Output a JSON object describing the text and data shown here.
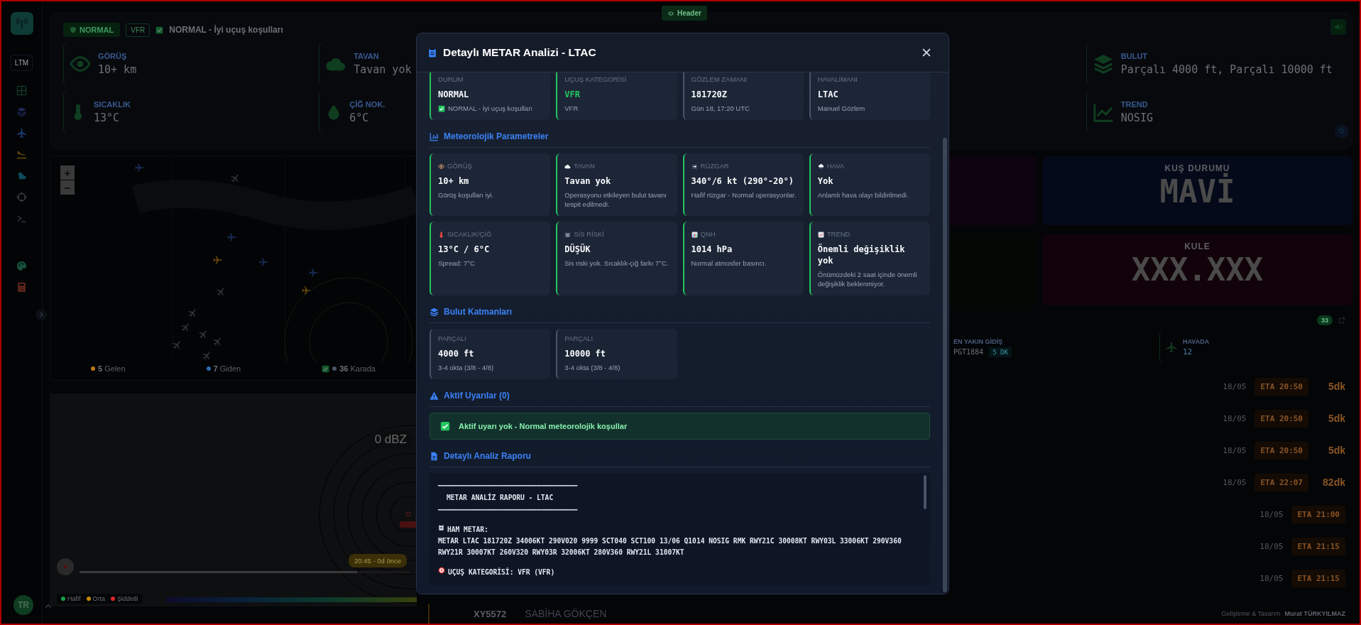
{
  "sidebar": {
    "airport": "LTM",
    "avatar": "TR"
  },
  "header_button": {
    "label": "Header"
  },
  "status": {
    "badge": "NORMAL",
    "category": "VFR",
    "checked": true,
    "text": "NORMAL - İyi uçuş koşulları"
  },
  "metric_columns": [
    [
      {
        "kind": "visibility",
        "label": "GÖRÜŞ",
        "value": "10+ km"
      },
      {
        "kind": "temperature",
        "label": "SICAKLIK",
        "value": "13°C"
      }
    ],
    [
      {
        "kind": "ceiling",
        "label": "TAVAN",
        "value": "Tavan yok"
      },
      {
        "kind": "dewpoint",
        "label": "ÇİĞ NOK.",
        "value": "6°C"
      }
    ],
    [
      {
        "kind": "cloud",
        "label": "BULUT",
        "value": "Parçalı 4000 ft, Parçalı 10000 ft"
      },
      {
        "kind": "trend",
        "label": "TREND",
        "value": "NOSIG"
      }
    ]
  ],
  "flight_map": {
    "zoom_in": "+",
    "zoom_out": "−",
    "ground_checked": true,
    "legend": [
      {
        "count": "5",
        "label": "Gelen",
        "color": "#b7791f"
      },
      {
        "count": "7",
        "label": "Giden",
        "color": "#2b6cb0"
      },
      {
        "count": "36",
        "label": "Karada",
        "color": "#4a5568"
      }
    ]
  },
  "radar": {
    "reading": "0 dBZ",
    "time": "20:45 - 0d önce",
    "timeline": {
      "level": 0.84
    },
    "legend": [
      {
        "label": "Hafif",
        "color": "#16a34a"
      },
      {
        "label": "Orta",
        "color": "#ca8a04"
      },
      {
        "label": "Şiddetli",
        "color": "#dc2626"
      }
    ]
  },
  "panels": {
    "bird": {
      "label": "KUŞ DURUMU",
      "value": "MAVİ"
    },
    "tower": {
      "label": "KULE",
      "value": "XXX.XXX"
    }
  },
  "flights": {
    "count": "33",
    "nearest": {
      "label": "EN YAKIN GİDİŞ",
      "callsign": "PGT1884",
      "eta": "5 DK"
    },
    "airborne": {
      "label": "HAVADA",
      "value": "12"
    },
    "rows": [
      {
        "date": "18/05",
        "eta": "ETA 20:50",
        "minutes": "5dk"
      },
      {
        "date": "18/05",
        "eta": "ETA 20:50",
        "minutes": "5dk"
      },
      {
        "date": "18/05",
        "eta": "ETA 20:50",
        "minutes": "5dk"
      },
      {
        "date": "18/05",
        "eta": "ETA 22:07",
        "minutes": "82dk"
      },
      {
        "date": "18/05",
        "eta": "ETA 21:00"
      },
      {
        "date": "18/05",
        "eta": "ETA 21:15"
      },
      {
        "date": "18/05",
        "eta": "ETA 21:15"
      }
    ]
  },
  "bottom_bar": {
    "flight": "XY5572",
    "airport": "SABİHA GÖKÇEN",
    "credit": "Geliştirme & Tasarım",
    "author": "Murat TÜRKYILMAZ"
  },
  "modal": {
    "title": "Detaylı METAR Analizi - LTAC",
    "summary": [
      {
        "label": "DURUM",
        "value": "NORMAL",
        "note": "NORMAL - İyi uçuş koşulları",
        "kind": "status",
        "accent": true
      },
      {
        "label": "UÇUŞ KATEGORİSİ",
        "value": "VFR",
        "note": "VFR",
        "kind": "category",
        "accent": true
      },
      {
        "label": "GÖZLEM ZAMANI",
        "value": "181720Z",
        "note": "Gün 18, 17:20 UTC",
        "kind": "plain",
        "accent": false
      },
      {
        "label": "HAVALİMANI",
        "value": "LTAC",
        "note": "Manuel Gözlem",
        "kind": "plain",
        "accent": false
      }
    ],
    "parameters_title": "Meteorolojik Parametreler",
    "parameters": [
      {
        "kind": "visibility",
        "label": "GÖRÜŞ",
        "value": "10+ km",
        "note": "Görüş koşulları iyi."
      },
      {
        "kind": "ceiling",
        "label": "TAVAN",
        "value": "Tavan yok",
        "note": "Operasyonu etkileyen bulut tavanı tespit edilmedi."
      },
      {
        "kind": "wind",
        "label": "RÜZGAR",
        "value": "340°/6 kt (290°-20°)",
        "note": "Hafif rüzgar - Normal operasyonlar."
      },
      {
        "kind": "weather",
        "label": "HAVA",
        "value": "Yok",
        "note": "Anlamlı hava olayı bildirilmedi."
      },
      {
        "kind": "temperature",
        "label": "SICAKLIK/ÇİĞ",
        "value": "13°C / 6°C",
        "note": "Spread: 7°C"
      },
      {
        "kind": "fog",
        "label": "SİS RİSKİ",
        "value": "DÜŞÜK",
        "note": "Sis riski yok. Sıcaklık-çiğ farkı 7°C."
      },
      {
        "kind": "pressure",
        "label": "QNH",
        "value": "1014 hPa",
        "note": "Normal atmosfer basıncı."
      },
      {
        "kind": "trend",
        "label": "TREND",
        "value": "Önemli değişiklik yok",
        "note": "Önümüzdeki 2 saat içinde önemli değişiklik beklenmiyor."
      }
    ],
    "clouds_title": "Bulut Katmanları",
    "clouds": [
      {
        "type": "PARÇALI",
        "height": "4000 ft",
        "note": "3-4 okta (3/8 - 4/8)"
      },
      {
        "type": "PARÇALI",
        "height": "10000 ft",
        "note": "3-4 okta (3/8 - 4/8)"
      }
    ],
    "alerts_title": "Aktif Uyarılar (0)",
    "alert_message": "Aktif uyarı yok - Normal meteorolojik koşullar",
    "report_title": "Detaylı Analiz Raporu",
    "report_lines": [
      {
        "kind": "rule",
        "text": "━━━━━━━━━━━━━━━━━━━━━━━━━━━━━━━━━━"
      },
      {
        "kind": "title",
        "text": "METAR ANALİZ RAPORU - LTAC"
      },
      {
        "kind": "rule",
        "text": "━━━━━━━━━━━━━━━━━━━━━━━━━━━━━━━━━━"
      },
      {
        "kind": "clipboard-heading",
        "text": "HAM METAR:"
      },
      {
        "kind": "text",
        "text": "METAR LTAC 181720Z 34006KT 290V020 9999 SCT040 SCT100 13/06 Q1014 NOSIG RMK RWY21C 30008KT RWY03L 33006KT 290V360 RWY21R 30007KT 260V320 RWY03R 32006KT 280V360 RWY21L 31007KT"
      },
      {
        "kind": "target-heading",
        "text": "UÇUŞ KATEGORİSİ: VFR (VFR)"
      }
    ]
  }
}
